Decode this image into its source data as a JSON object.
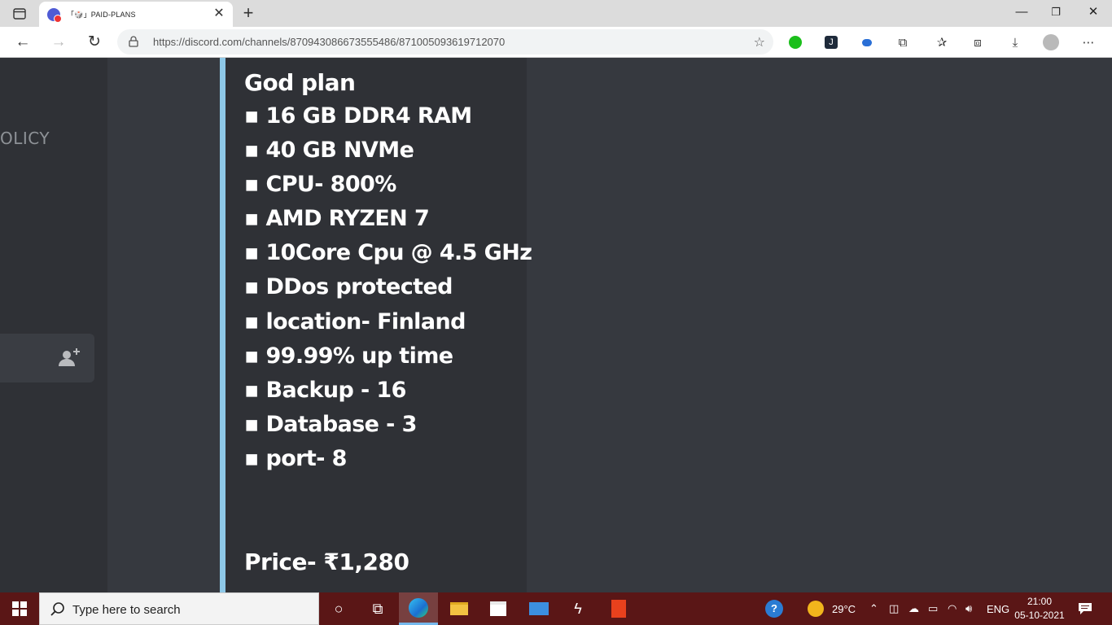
{
  "browser": {
    "tab_title": "「🎲」PAID-PLANS",
    "tab_close": "✕",
    "new_tab": "+",
    "url": "https://discord.com/channels/870943086673555486/871005093619712070",
    "window_controls": {
      "minimize": "—",
      "maximize": "❐",
      "close": "✕"
    }
  },
  "sidebar": {
    "category_label": "OLICY"
  },
  "message": {
    "accent_color": "#8ec8e8",
    "title": "God plan",
    "specs": [
      "▪ 16 GB DDR4 RAM",
      "▪ 40 GB NVMe",
      "▪  CPU- 800%",
      "▪ AMD RYZEN 7",
      "▪ 10Core Cpu @ 4.5 GHz",
      "▪ DDos protected",
      "▪ location- Finland",
      "▪  99.99% up time",
      "▪  Backup - 16",
      "▪ Database - 3",
      "▪  port- 8"
    ],
    "price": "Price- ₹1,280"
  },
  "taskbar": {
    "search_placeholder": "Type here to search",
    "weather": "29°C",
    "language": "ENG",
    "time": "21:00",
    "date": "05-10-2021"
  }
}
